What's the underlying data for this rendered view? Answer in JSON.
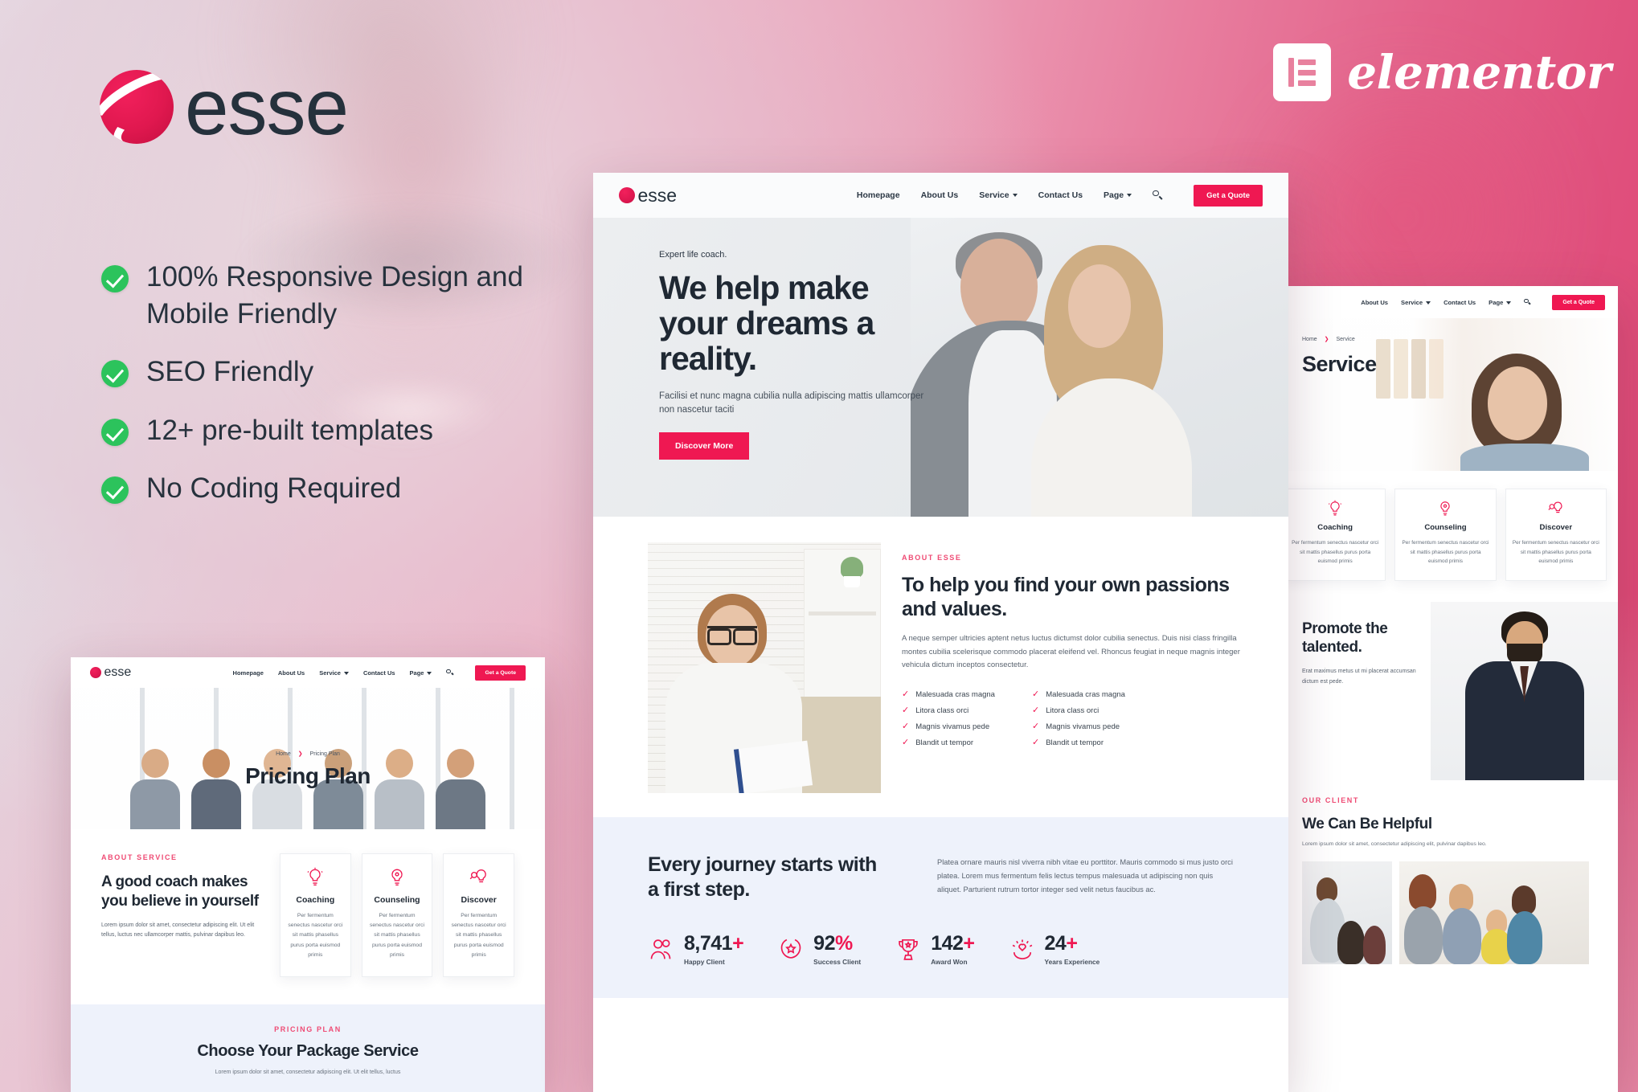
{
  "brand": {
    "name": "esse",
    "logo_icon": "esse-swirl-logo"
  },
  "badge": {
    "name": "elementor",
    "icon": "elementor-logo-icon"
  },
  "features": [
    "100% Responsive Design and Mobile Friendly",
    "SEO Friendly",
    "12+ pre-built templates",
    "No Coding Required"
  ],
  "nav": {
    "items": [
      "Homepage",
      "About Us",
      "Service",
      "Contact Us",
      "Page"
    ],
    "dropdown_items": [
      "Service",
      "Page"
    ],
    "search_icon": "search-icon",
    "cta": "Get a Quote"
  },
  "accent": "#ef1852",
  "accent_soft": "#ef4b74",
  "home": {
    "hero": {
      "eyebrow": "Expert life coach.",
      "title": "We help make your dreams a reality.",
      "subtitle": "Facilisi et nunc magna cubilia nulla adipiscing mattis ullamcorper non nascetur taciti",
      "button": "Discover More"
    },
    "about": {
      "kicker": "ABOUT ESSE",
      "title": "To help you find your own passions and values.",
      "paragraph": "A neque semper ultricies aptent netus luctus dictumst dolor cubilia senectus. Duis nisi class fringilla montes cubilia scelerisque commodo placerat eleifend vel. Rhoncus feugiat in neque magnis integer vehicula dictum inceptos consectetur.",
      "list_left": [
        "Malesuada cras magna",
        "Litora class orci",
        "Magnis vivamus pede",
        "Blandit ut tempor"
      ],
      "list_right": [
        "Malesuada cras magna",
        "Litora class orci",
        "Magnis vivamus pede",
        "Blandit ut tempor"
      ]
    },
    "stats_section": {
      "title": "Every journey starts with a first step.",
      "paragraph": "Platea ornare mauris nisl viverra nibh vitae eu porttitor. Mauris commodo si mus justo orci platea. Lorem mus fermentum felis lectus tempus malesuada ut adipiscing non quis aliquet. Parturient rutrum tortor integer sed velit netus faucibus ac.",
      "stats": [
        {
          "value": "8,741",
          "suffix": "+",
          "label": "Happy Client",
          "icon": "people-icon"
        },
        {
          "value": "92",
          "suffix": "%",
          "label": "Success Client",
          "icon": "laurel-star-icon"
        },
        {
          "value": "142",
          "suffix": "+",
          "label": "Award Won",
          "icon": "trophy-icon"
        },
        {
          "value": "24",
          "suffix": "+",
          "label": "Years Experience",
          "icon": "heart-hands-icon"
        }
      ]
    }
  },
  "pricing_page": {
    "breadcrumb": {
      "home": "Home",
      "current": "Pricing Plan"
    },
    "title": "Pricing Plan",
    "about_service": {
      "kicker": "ABOUT SERVICE",
      "title": "A good coach makes you believe in yourself",
      "paragraph": "Lorem ipsum dolor sit amet, consectetur adipiscing elit. Ut elit tellus, luctus nec ullamcorper mattis, pulvinar dapibus leo."
    },
    "cards": [
      {
        "title": "Coaching",
        "text": "Per fermentum senectus nascetur orci sit mattis phasellus purus porta euismod primis",
        "icon": "lightbulb-icon"
      },
      {
        "title": "Counseling",
        "text": "Per fermentum senectus nascetur orci sit mattis phasellus purus porta euismod primis",
        "icon": "lightbulb-gear-icon"
      },
      {
        "title": "Discover",
        "text": "Per fermentum senectus nascetur orci sit mattis phasellus purus porta euismod primis",
        "icon": "lightbulb-search-icon"
      }
    ],
    "plan": {
      "kicker": "PRICING PLAN",
      "title": "Choose Your Package Service",
      "paragraph": "Lorem ipsum dolor sit amet, consectetur adipiscing elit. Ut elit tellus, luctus"
    }
  },
  "service_page": {
    "breadcrumb": {
      "home": "Home",
      "current": "Service"
    },
    "title": "Service",
    "cards": [
      {
        "title": "Coaching",
        "text": "Per fermentum senectus nascetur orci sit mattis phasellus purus porta euismod primis",
        "icon": "lightbulb-icon"
      },
      {
        "title": "Counseling",
        "text": "Per fermentum senectus nascetur orci sit mattis phasellus purus porta euismod primis",
        "icon": "lightbulb-gear-icon"
      },
      {
        "title": "Discover",
        "text": "Per fermentum senectus nascetur orci sit mattis phasellus purus porta euismod primis",
        "icon": "lightbulb-search-icon"
      }
    ],
    "promote": {
      "title": "Promote the talented.",
      "paragraph": "Erat maximus metus ut mi placerat accumsan dictum est pede."
    },
    "client": {
      "kicker": "OUR CLIENT",
      "title": "We Can Be Helpful",
      "paragraph": "Lorem ipsum dolor sit amet, consectetur adipiscing elit, pulvinar dapibus leo."
    }
  }
}
